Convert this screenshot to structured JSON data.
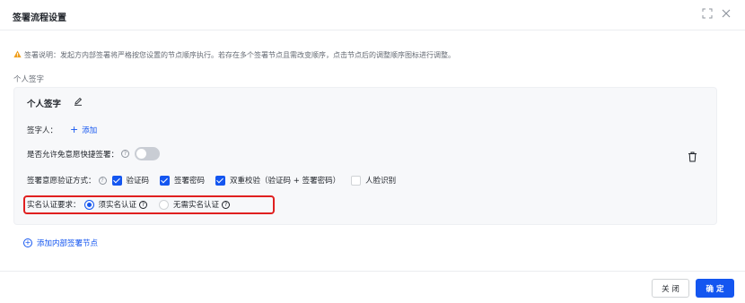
{
  "dialog": {
    "title": "签署流程设置",
    "notice": "签署说明：发起方内部签署将严格按您设置的节点顺序执行。若存在多个签署节点且需改变顺序，点击节点后的调整顺序图标进行调整。",
    "section_label": "个人签字"
  },
  "node": {
    "title": "个人签字",
    "signer_label": "签字人：",
    "add_signer": "添加",
    "quick_sign_label": "是否允许免意愿快捷签署：",
    "quick_sign_enabled": false,
    "verify_label": "签署意愿验证方式：",
    "verify_options": [
      {
        "label": "验证码",
        "checked": true
      },
      {
        "label": "签署密码",
        "checked": true
      },
      {
        "label": "双重校验（验证码 + 签署密码）",
        "checked": true
      },
      {
        "label": "人脸识别",
        "checked": false
      }
    ],
    "realname_label": "实名认证要求：",
    "realname_options": [
      {
        "label": "须实名认证",
        "selected": true
      },
      {
        "label": "无需实名认证",
        "selected": false
      }
    ]
  },
  "add_node_label": "添加内部签署节点",
  "footer": {
    "close_label": "关 闭",
    "ok_label": "确 定"
  },
  "colors": {
    "accent": "#1456f0",
    "highlight": "#e02020",
    "warning": "#f0a020"
  }
}
